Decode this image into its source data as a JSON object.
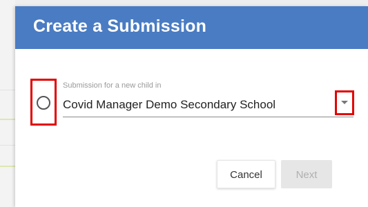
{
  "dialog": {
    "title": "Create a Submission",
    "header_color": "#4a7cc3"
  },
  "option": {
    "caption": "Submission for a new child in",
    "selected_school": "Covid Manager Demo Secondary School",
    "selected": false
  },
  "buttons": {
    "cancel_label": "Cancel",
    "next_label": "Next",
    "next_disabled": true
  },
  "annotations": {
    "highlight_color": "#e10000"
  }
}
